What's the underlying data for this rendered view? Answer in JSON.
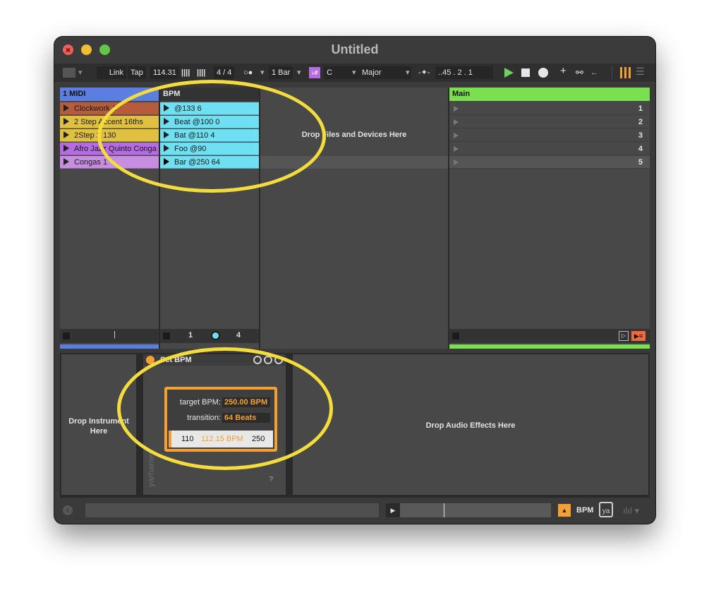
{
  "window": {
    "title": "Untitled"
  },
  "toolbar": {
    "link": "Link",
    "tap": "Tap",
    "tempo": "114.31",
    "time_signature": "4 / 4",
    "metronome": "○●",
    "quantize": "1 Bar",
    "key_icon": "♭#",
    "key_root": "C",
    "scale": "Major",
    "arrangement_position": "..45 .   2 .   1",
    "follow_icon": "-✦-",
    "add_icon": "+",
    "link_icon": "⚯",
    "back_icon": "←"
  },
  "tracks": {
    "midi": {
      "name": "1 MIDI",
      "color": "#5a7fe0",
      "clips": [
        {
          "name": "Clockwork 1",
          "color": "#b45c3c"
        },
        {
          "name": "2 Step Accent 16ths",
          "color": "#e0c040"
        },
        {
          "name": "2Step 2 130",
          "color": "#e0c040"
        },
        {
          "name": "Afro Jazz Quinto Conga",
          "color": "#b46ce0"
        },
        {
          "name": "Congas 1",
          "color": "#c78de0"
        }
      ],
      "footer_marker": "|"
    },
    "bpm": {
      "name": "BPM",
      "color": "#3a3a3a",
      "clips": [
        {
          "name": "@133 6",
          "color": "#6fe0f2"
        },
        {
          "name": "Beat @100 0",
          "color": "#6fe0f2"
        },
        {
          "name": "Bat @110 4",
          "color": "#6fe0f2"
        },
        {
          "name": "Foo @90",
          "color": "#6fe0f2"
        },
        {
          "name": "Bar @250 64",
          "color": "#6fe0f2"
        }
      ],
      "footer_left": "1",
      "footer_right": "4"
    },
    "drop_zone": "Drop Files and Devices Here",
    "main": {
      "name": "Main",
      "color": "#7ae04f",
      "scenes": [
        "1",
        "2",
        "3",
        "4",
        "5"
      ]
    }
  },
  "devices": {
    "drop_instrument": "Drop Instrument Here",
    "device": {
      "title": "Set BPM",
      "vertical_label": "yarhamer",
      "target_label": "target BPM:",
      "target_value": "250.00 BPM",
      "transition_label": "transition:",
      "transition_value": "64 Beats",
      "meter_left": "110",
      "meter_mid": "112.15 BPM",
      "meter_right": "250",
      "help": "?"
    },
    "drop_effects": "Drop Audio Effects Here"
  },
  "statusbar": {
    "info": "i",
    "selected_track": "BPM",
    "track_box": "ya"
  }
}
